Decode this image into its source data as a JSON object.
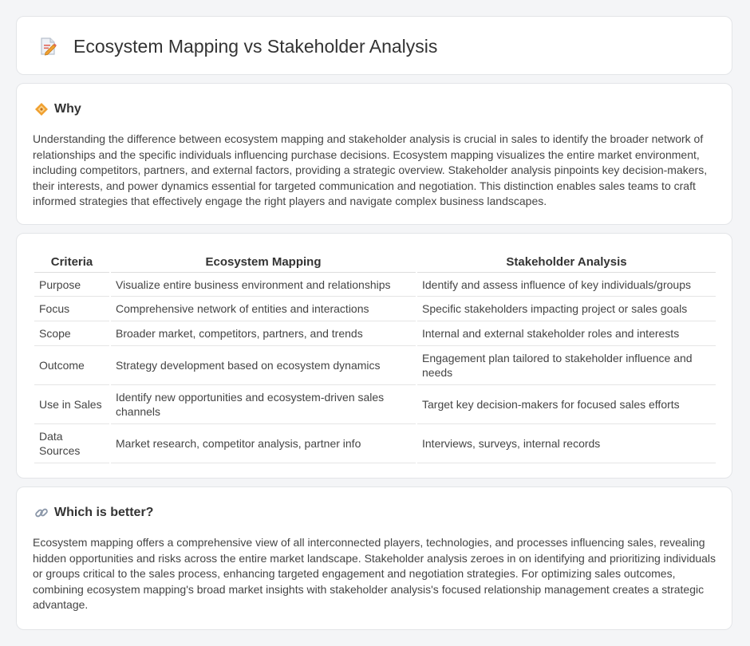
{
  "header": {
    "title": "Ecosystem Mapping vs Stakeholder Analysis",
    "icon": "document-pencil-icon"
  },
  "why": {
    "heading": "Why",
    "icon": "diamond-icon",
    "body": "Understanding the difference between ecosystem mapping and stakeholder analysis is crucial in sales to identify the broader network of relationships and the specific individuals influencing purchase decisions. Ecosystem mapping visualizes the entire market environment, including competitors, partners, and external factors, providing a strategic overview. Stakeholder analysis pinpoints key decision-makers, their interests, and power dynamics essential for targeted communication and negotiation. This distinction enables sales teams to craft informed strategies that effectively engage the right players and navigate complex business landscapes."
  },
  "table": {
    "headers": [
      "Criteria",
      "Ecosystem Mapping",
      "Stakeholder Analysis"
    ],
    "rows": [
      [
        "Purpose",
        "Visualize entire business environment and relationships",
        "Identify and assess influence of key individuals/groups"
      ],
      [
        "Focus",
        "Comprehensive network of entities and interactions",
        "Specific stakeholders impacting project or sales goals"
      ],
      [
        "Scope",
        "Broader market, competitors, partners, and trends",
        "Internal and external stakeholder roles and interests"
      ],
      [
        "Outcome",
        "Strategy development based on ecosystem dynamics",
        "Engagement plan tailored to stakeholder influence and needs"
      ],
      [
        "Use in Sales",
        "Identify new opportunities and ecosystem-driven sales channels",
        "Target key decision-makers for focused sales efforts"
      ],
      [
        "Data Sources",
        "Market research, competitor analysis, partner info",
        "Interviews, surveys, internal records"
      ]
    ]
  },
  "better": {
    "heading": "Which is better?",
    "icon": "link-icon",
    "body": "Ecosystem mapping offers a comprehensive view of all interconnected players, technologies, and processes influencing sales, revealing hidden opportunities and risks across the entire market landscape. Stakeholder analysis zeroes in on identifying and prioritizing individuals or groups critical to the sales process, enhancing targeted engagement and negotiation strategies. For optimizing sales outcomes, combining ecosystem mapping's broad market insights with stakeholder analysis's focused relationship management creates a strategic advantage."
  },
  "colors": {
    "background": "#f4f5f7",
    "card": "#ffffff",
    "accent": "#f0a030"
  }
}
